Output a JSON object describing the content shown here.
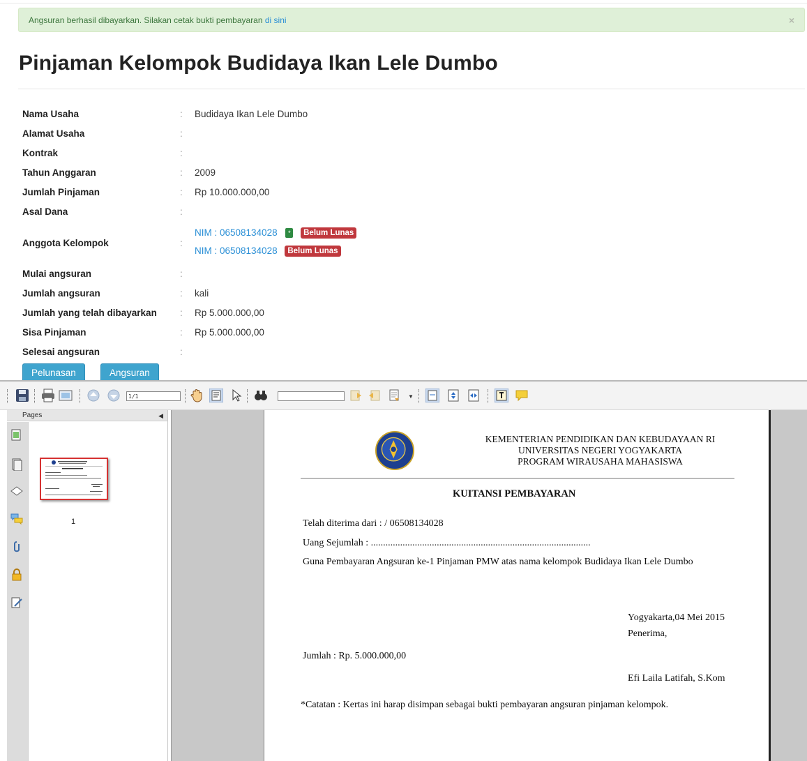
{
  "alert": {
    "message": "Angsuran berhasil dibayarkan. Silakan cetak bukti pembayaran",
    "link": "di sini",
    "close": "×"
  },
  "page_title": "Pinjaman Kelompok Budidaya Ikan Lele Dumbo",
  "info": {
    "colon": ":",
    "rows": [
      {
        "label": "Nama Usaha",
        "value": "Budidaya Ikan Lele Dumbo"
      },
      {
        "label": "Alamat Usaha",
        "value": ""
      },
      {
        "label": "Kontrak",
        "value": ""
      },
      {
        "label": "Tahun Anggaran",
        "value": "2009"
      },
      {
        "label": "Jumlah Pinjaman",
        "value": "Rp 10.000.000,00"
      },
      {
        "label": "Asal Dana",
        "value": ""
      }
    ],
    "members_label": "Anggota Kelompok",
    "members": [
      {
        "nim": "NIM : 06508134028",
        "badge": "*",
        "status": "Belum Lunas"
      },
      {
        "nim": "NIM : 06508134028",
        "status": "Belum Lunas"
      }
    ],
    "rows2": [
      {
        "label": "Mulai angsuran",
        "value": ""
      },
      {
        "label": "Jumlah angsuran",
        "value": "kali"
      },
      {
        "label": "Jumlah yang telah dibayarkan",
        "value": "Rp 5.000.000,00"
      },
      {
        "label": "Sisa Pinjaman",
        "value": "Rp 5.000.000,00"
      },
      {
        "label": "Selesai angsuran",
        "value": ""
      }
    ]
  },
  "buttons": {
    "pelunasan": "Pelunasan",
    "angsuran": "Angsuran"
  },
  "viewer": {
    "page_indicator": "1/1",
    "sidebar_title": "Pages",
    "thumbnail_page": "1",
    "document": {
      "header_line1": "KEMENTERIAN PENDIDIKAN DAN KEBUDAYAAN RI",
      "header_line2": "UNIVERSITAS NEGERI YOGYAKARTA",
      "header_line3": "PROGRAM WIRAUSAHA MAHASISWA",
      "title": "KUITANSI PEMBAYARAN",
      "received_from": "Telah diterima dari :   / 06508134028",
      "amount_words": "Uang Sejumlah       :  ..........................................................................................",
      "purpose": "Guna Pembayaran Angsuran ke-1 Pinjaman PMW atas nama kelompok Budidaya Ikan Lele Dumbo",
      "place_date": "Yogyakarta,04 Mei 2015",
      "receiver": "Penerima,",
      "total": "Jumlah : Rp. 5.000.000,00",
      "signer": "Efi Laila Latifah, S.Kom",
      "note": "*Catatan : Kertas ini harap disimpan sebagai bukti pembayaran angsuran pinjaman kelompok."
    }
  }
}
